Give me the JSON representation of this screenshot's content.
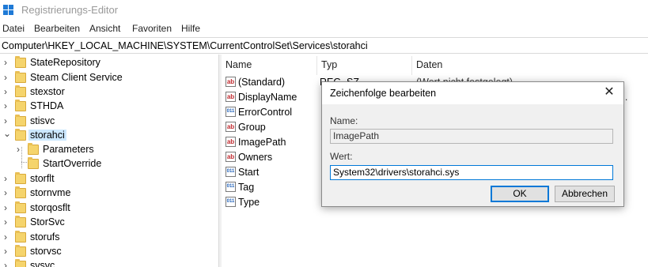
{
  "window": {
    "title": "Registrierungs-Editor"
  },
  "menu": {
    "items": [
      "Datei",
      "Bearbeiten",
      "Ansicht",
      "Favoriten",
      "Hilfe"
    ]
  },
  "address": "Computer\\HKEY_LOCAL_MACHINE\\SYSTEM\\CurrentControlSet\\Services\\storahci",
  "tree": {
    "items": [
      {
        "label": "StateRepository",
        "expander": "›"
      },
      {
        "label": "Steam Client Service",
        "expander": "›"
      },
      {
        "label": "stexstor",
        "expander": "›"
      },
      {
        "label": "STHDA",
        "expander": "›"
      },
      {
        "label": "stisvc",
        "expander": "›"
      },
      {
        "label": "storahci",
        "expander": "⌄"
      },
      {
        "label": "Parameters",
        "expander": "›"
      },
      {
        "label": "StartOverride",
        "expander": ""
      },
      {
        "label": "storflt",
        "expander": "›"
      },
      {
        "label": "stornvme",
        "expander": "›"
      },
      {
        "label": "storqosflt",
        "expander": "›"
      },
      {
        "label": "StorSvc",
        "expander": "›"
      },
      {
        "label": "storufs",
        "expander": "›"
      },
      {
        "label": "storvsc",
        "expander": "›"
      },
      {
        "label": "svsvc",
        "expander": "›"
      }
    ]
  },
  "list": {
    "headers": {
      "name": "Name",
      "type": "Typ",
      "data": "Daten"
    },
    "rows": [
      {
        "icon": "ab",
        "name": "(Standard)",
        "type": "REG_SZ",
        "data": "(Wert nicht festgelegt)"
      },
      {
        "icon": "ab",
        "name": "DisplayName",
        "type": "",
        "data": ""
      },
      {
        "icon": "011",
        "name": "ErrorControl",
        "type": "",
        "data": ""
      },
      {
        "icon": "ab",
        "name": "Group",
        "type": "",
        "data": ""
      },
      {
        "icon": "ab",
        "name": "ImagePath",
        "type": "",
        "data": ""
      },
      {
        "icon": "ab",
        "name": "Owners",
        "type": "",
        "data": ""
      },
      {
        "icon": "011",
        "name": "Start",
        "type": "",
        "data": ""
      },
      {
        "icon": "011",
        "name": "Tag",
        "type": "",
        "data": ""
      },
      {
        "icon": "011",
        "name": "Type",
        "type": "",
        "data": ""
      }
    ],
    "overflow_text": "o..."
  },
  "dialog": {
    "title": "Zeichenfolge bearbeiten",
    "close": "✕",
    "name_label": "Name:",
    "name_value": "ImagePath",
    "value_label": "Wert:",
    "value_value": "System32\\drivers\\storahci.sys",
    "ok_label": "OK",
    "cancel_label": "Abbrechen"
  },
  "colors": {
    "accent": "#0078d7",
    "selection": "#cce8ff",
    "folder": "#f5d46c"
  }
}
